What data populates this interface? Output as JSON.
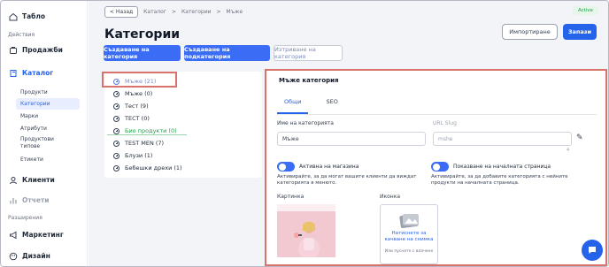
{
  "sidebar": {
    "items": [
      {
        "label": "Табло",
        "icon": "home-icon"
      },
      {
        "label": "Продажби",
        "icon": "cart-icon"
      },
      {
        "label": "Каталог",
        "icon": "catalog-icon"
      },
      {
        "label": "Клиенти",
        "icon": "users-icon"
      },
      {
        "label": "Отчети",
        "icon": "reports-icon"
      },
      {
        "label": "Маркетинг",
        "icon": "megaphone-icon"
      },
      {
        "label": "Дизайн",
        "icon": "design-icon"
      }
    ],
    "sections": {
      "actions": "Действия",
      "extensions": "Разширения"
    },
    "catalog_sub": [
      "Продукти",
      "Категории",
      "Марки",
      "Атрибути",
      "Продуктови типове",
      "Етикети"
    ]
  },
  "breadcrumb": {
    "back": "< Назад",
    "level1": "Каталог",
    "level2": "Категории",
    "level3": "Мъже",
    "sep": ">"
  },
  "status": "Active",
  "page_title": "Категории",
  "header_buttons": {
    "import": "Импортиране",
    "save": "Запази"
  },
  "actions": {
    "create_category": "Създаване на категория",
    "create_subcategory": "Създаване на подкатегория",
    "delete_category": "Изтриване на категория"
  },
  "categories": [
    "Мъже (21)",
    "Мъже (0)",
    "Тест (9)",
    "ТЕСТ (0)",
    "Био продукти (0)",
    "TEST MEN (7)",
    "Блузи (1)",
    "Бебешки дрехи (1)"
  ],
  "edit": {
    "title": "Мъже категория",
    "tabs": [
      "Общи",
      "SEO"
    ],
    "name_label": "Име на категорията",
    "name_value": "Мъже",
    "slug_label": "URL Slug",
    "slug_value": "mshe",
    "slug_count": "4",
    "active_label": "Активна на магазина",
    "active_help": "Активирайте, за да могат вашите клиенти да виждат категорията в менюто.",
    "home_label": "Показване на началната страница",
    "home_help": "Активирайте, за да добавите категорията с нейните продукти на началната страница.",
    "image_label": "Картинка",
    "icon_label": "Иконка",
    "upload_cta": "Натиснете за качване на снимка",
    "upload_hint": "Или пуснете с влачене"
  },
  "colors": {
    "accent": "#2563eb",
    "highlight": "#d9726b",
    "active_badge": "#16a34a"
  }
}
